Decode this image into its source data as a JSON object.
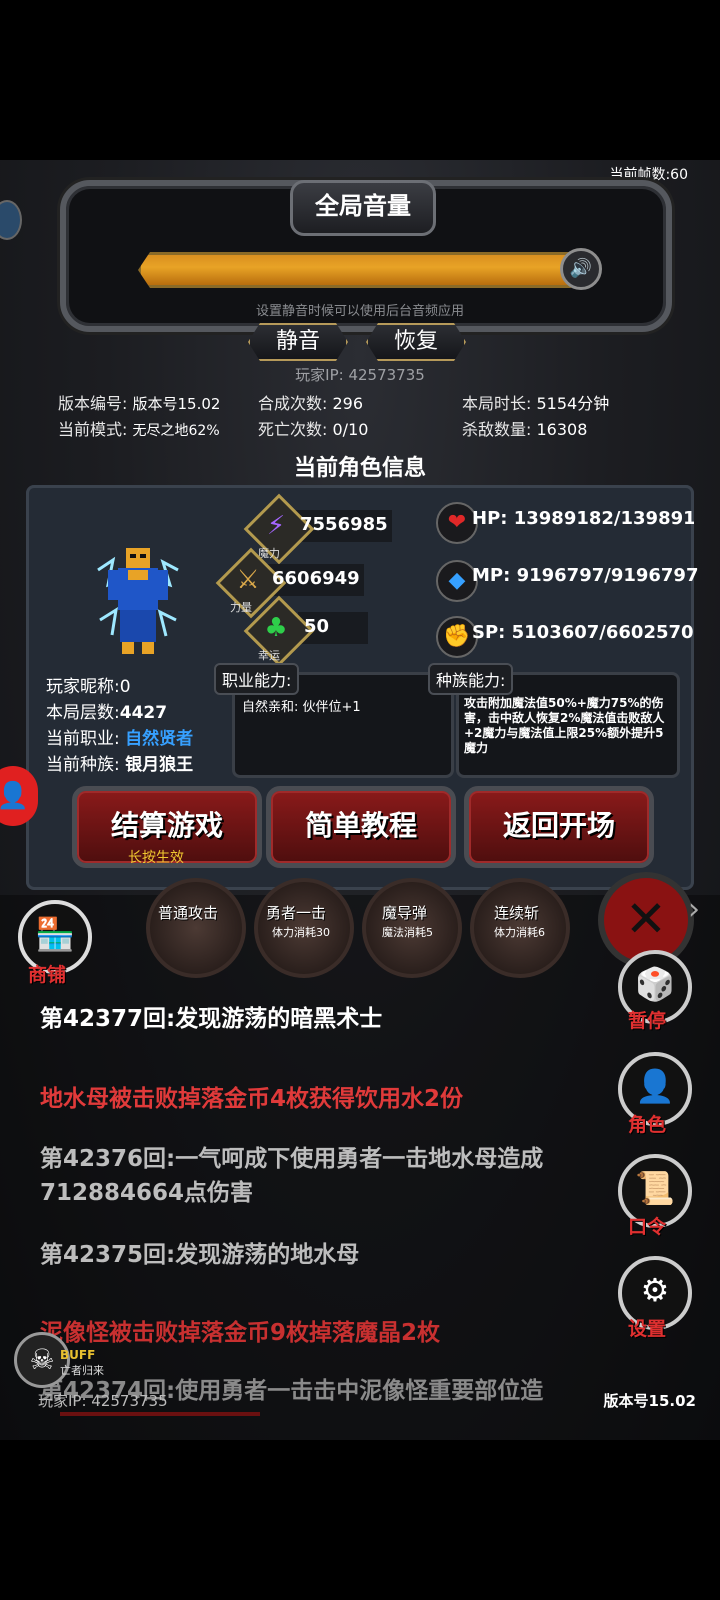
{
  "hud": {
    "fps": "当前帧数:60",
    "version_bottom": "版本号15.02",
    "player_ip_bottom": "玩家IP:  42573735"
  },
  "volume": {
    "title": "全局音量",
    "level": 1.0,
    "hint": "设置静音时候可以使用后台音频应用",
    "mute_label": "静音",
    "restore_label": "恢复",
    "player_ip": "玩家IP:  42573735"
  },
  "stats": {
    "version_k": "版本编号:",
    "version_v": "版本号15.02",
    "mode_k": "当前模式:",
    "mode_v": "无尽之地62%",
    "synth_k": "合成次数:",
    "synth_v": "296",
    "death_k": "死亡次数:",
    "death_v": "0/10",
    "time_k": "本局时长:",
    "time_v": "5154分钟",
    "kills_k": "杀敌数量:",
    "kills_v": "16308"
  },
  "character": {
    "title": "当前角色信息",
    "magic_label": "魔力",
    "magic": "7556985",
    "power_label": "力量",
    "power": "6606949",
    "luck_label": "幸运",
    "luck": "50",
    "hp": "HP:  13989182/13989182",
    "mp": "MP:  9196797/9196797",
    "sp": "SP:  5103607/6602570",
    "nickname_k": "玩家昵称:",
    "nickname_v": "0",
    "floor_k": "本局层数:",
    "floor_v": "4427",
    "class_k": "当前职业:",
    "class_v": "自然贤者",
    "race_k": "当前种族:",
    "race_v": "银月狼王",
    "class_ability_title": "职业能力:",
    "class_ability_text": "自然亲和:  伙伴位+1",
    "race_ability_title": "种族能力:",
    "race_ability_text": "攻击附加魔法值50%+魔力75%的伤害，击中敌人恢复2%魔法值击败敌人+2魔力与魔法值上限25%额外提升5魔力"
  },
  "actions": {
    "settle": "结算游戏",
    "settle_hint": "长按生效",
    "tutorial": "简单教程",
    "back": "返回开场"
  },
  "skills": [
    {
      "name": "普通攻击",
      "cost": ""
    },
    {
      "name": "勇者一击",
      "cost": "体力消耗30"
    },
    {
      "name": "魔导弹",
      "cost": "魔法消耗5"
    },
    {
      "name": "连续斩",
      "cost": "体力消耗6"
    }
  ],
  "side": {
    "shop": "商铺",
    "pause": "暂停",
    "role": "角色",
    "code": "口令",
    "settings": "设置",
    "buff": "BUFF",
    "buff_sub": "亡者归来"
  },
  "log": [
    {
      "text": "第42377回:发现游荡的暗黑术士",
      "color": "#ffffff"
    },
    {
      "text": "地水母被击败掉落金币4枚获得饮用水2份",
      "color": "#e03a3a"
    },
    {
      "text": "第42376回:一气呵成下使用勇者一击地水母造成712884664点伤害",
      "color": "#bdbdbd"
    },
    {
      "text": "第42375回:发现游荡的地水母",
      "color": "#bdbdbd"
    },
    {
      "text": "泥像怪被击败掉落金币9枚掉落魔晶2枚",
      "color": "#c83030"
    },
    {
      "text": "第42374回:使用勇者一击击中泥像怪重要部位造",
      "color": "#8a8a8a"
    }
  ],
  "colors": {
    "accent_red": "#e03030",
    "gold": "#e8a326",
    "cyan": "#36a0ff"
  }
}
